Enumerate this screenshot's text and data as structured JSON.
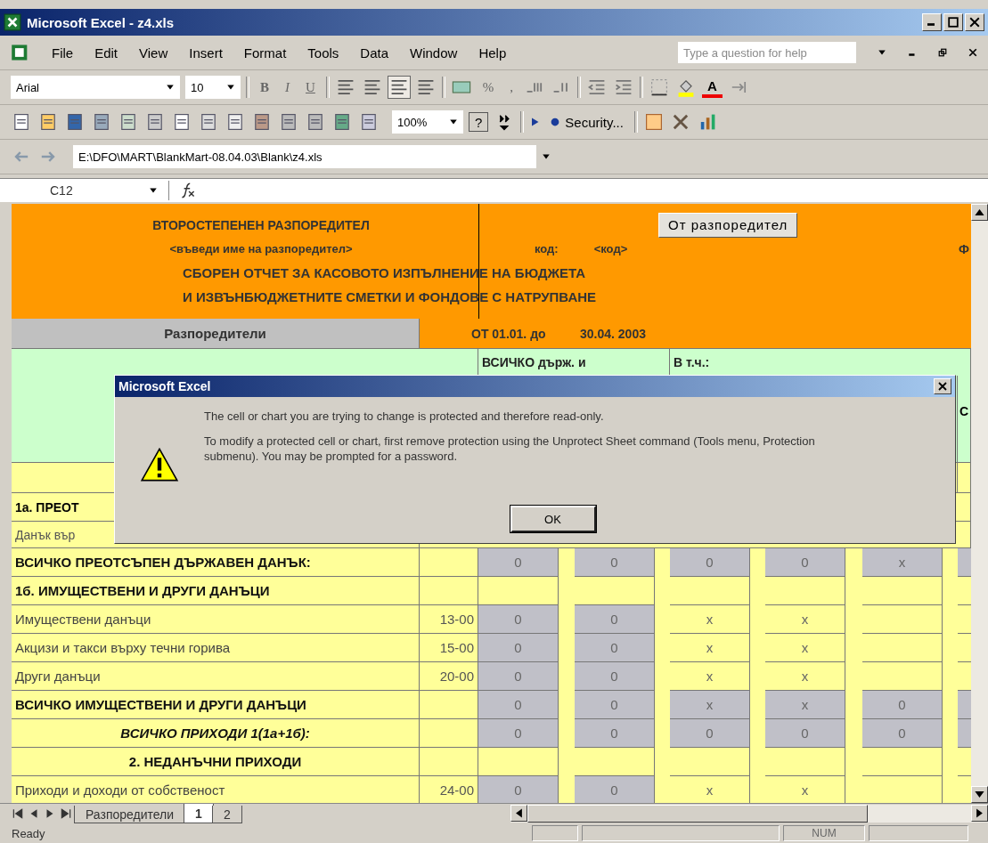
{
  "window": {
    "title": "Microsoft Excel - z4.xls"
  },
  "menu": [
    "File",
    "Edit",
    "View",
    "Insert",
    "Format",
    "Tools",
    "Data",
    "Window",
    "Help"
  ],
  "help_search": {
    "placeholder": "Type a question for help"
  },
  "formatting_toolbar": {
    "font": "Arial",
    "size": "10",
    "style_buttons": [
      "B",
      "I",
      "U"
    ],
    "number_buttons": [
      "%",
      ","
    ],
    "font_color_letter": "A"
  },
  "standard_toolbar": {
    "zoom": "100%",
    "help": "?",
    "security": "Security..."
  },
  "web_toolbar": {
    "address": "E:\\DFO\\MART\\BlankMart-08.04.03\\Blank\\z4.xls"
  },
  "formula_bar": {
    "name_box": "C12"
  },
  "sheet": {
    "header": {
      "title": "ВТОРОСТЕПЕНЕН РАЗПОРЕДИТЕЛ",
      "name_hint": "<въведи име на разпоредител>",
      "button": "От разпоредител",
      "code_label": "код:",
      "code_hint": "<код>",
      "right_cut": "Ф",
      "report_line_1": "СБОРЕН ОТЧЕТ ЗА КАСОВОТО ИЗПЪЛНЕНИЕ НА БЮДЖЕТА",
      "report_line_2": "И ИЗВЪНБЮДЖЕТНИТЕ СМЕТКИ И ФОНДОВЕ С НАТРУПВАНЕ",
      "column_label": "Разпоредители",
      "period_from": "ОТ 01.01. до",
      "period_to": "30.04. 2003"
    },
    "upper": {
      "total_label": "ВСИЧКО държ. и",
      "incl_label": "В т.ч.:",
      "right_cut": "С",
      "section_cut": "1а. ПРЕОТ",
      "item_cut": "Данък вър"
    },
    "rows": [
      {
        "kind": "total",
        "label": "ВСИЧКО ПРЕОТСЪПЕН ДЪРЖАВЕН ДАНЪК:",
        "cells": [
          {
            "value": "0",
            "shaded": true
          },
          {
            "value": "0",
            "shaded": true
          },
          {
            "value": "0",
            "shaded": true
          },
          {
            "value": "0",
            "shaded": true
          },
          {
            "value": "x",
            "shaded": true
          },
          {
            "shaded": true
          }
        ]
      },
      {
        "kind": "section",
        "label": "1б. ИМУЩЕСТВЕНИ И ДРУГИ ДАНЪЦИ",
        "cells": [
          {
            "shaded": false
          },
          {
            "shaded": false
          },
          {
            "shaded": false
          },
          {
            "shaded": false
          },
          {
            "shaded": false
          },
          {
            "shaded": false
          }
        ]
      },
      {
        "kind": "item",
        "label": "Имуществени данъци",
        "code": "13-00",
        "cells": [
          {
            "value": "0",
            "shaded": true
          },
          {
            "value": "0",
            "shaded": true
          },
          {
            "value": "x",
            "shaded": false
          },
          {
            "value": "x",
            "shaded": false
          },
          {
            "shaded": false
          },
          {
            "shaded": false
          }
        ]
      },
      {
        "kind": "item",
        "label": "Акцизи и такси върху течни горива",
        "code": "15-00",
        "cells": [
          {
            "value": "0",
            "shaded": true
          },
          {
            "value": "0",
            "shaded": true
          },
          {
            "value": "x",
            "shaded": false
          },
          {
            "value": "x",
            "shaded": false
          },
          {
            "shaded": false
          },
          {
            "shaded": false
          }
        ]
      },
      {
        "kind": "item",
        "label": "Други данъци",
        "code": "20-00",
        "cells": [
          {
            "value": "0",
            "shaded": true
          },
          {
            "value": "0",
            "shaded": true
          },
          {
            "value": "x",
            "shaded": false
          },
          {
            "value": "x",
            "shaded": false
          },
          {
            "shaded": false
          },
          {
            "shaded": false
          }
        ]
      },
      {
        "kind": "total",
        "label": "ВСИЧКО ИМУЩЕСТВЕНИ И ДРУГИ ДАНЪЦИ",
        "cells": [
          {
            "value": "0",
            "shaded": true
          },
          {
            "value": "0",
            "shaded": true
          },
          {
            "value": "x",
            "shaded": true
          },
          {
            "value": "x",
            "shaded": true
          },
          {
            "value": "0",
            "shaded": true
          },
          {
            "shaded": true
          }
        ]
      },
      {
        "kind": "grand_total",
        "label": "ВСИЧКО ПРИХОДИ 1(1а+1б):",
        "cells": [
          {
            "value": "0",
            "shaded": true
          },
          {
            "value": "0",
            "shaded": true
          },
          {
            "value": "0",
            "shaded": true
          },
          {
            "value": "0",
            "shaded": true
          },
          {
            "value": "0",
            "shaded": true
          },
          {
            "shaded": true
          }
        ]
      },
      {
        "kind": "heading",
        "label": "2. НЕДАНЪЧНИ ПРИХОДИ",
        "cells": [
          {
            "shaded": false
          },
          {
            "shaded": false
          },
          {
            "shaded": false
          },
          {
            "shaded": false
          },
          {
            "shaded": false
          },
          {
            "shaded": false
          }
        ]
      },
      {
        "kind": "item",
        "label": "Приходи и доходи от собственост",
        "code": "24-00",
        "cells": [
          {
            "value": "0",
            "shaded": true
          },
          {
            "value": "0",
            "shaded": true
          },
          {
            "value": "x",
            "shaded": false
          },
          {
            "value": "x",
            "shaded": false
          },
          {
            "shaded": false
          },
          {
            "shaded": false
          }
        ]
      }
    ]
  },
  "dialog": {
    "title": "Microsoft Excel",
    "messages": [
      "The cell or chart you are trying to change is protected and therefore read-only.",
      "To modify a protected cell or chart, first remove protection using the Unprotect Sheet command (Tools menu, Protection submenu). You may be prompted for a password."
    ],
    "button": "OK"
  },
  "sheet_tabs": [
    {
      "label": "Разпоредители",
      "selected": false
    },
    {
      "label": "1",
      "selected": true
    },
    {
      "label": "2",
      "selected": false
    }
  ],
  "status_bar": {
    "status": "Ready",
    "num": "NUM"
  }
}
